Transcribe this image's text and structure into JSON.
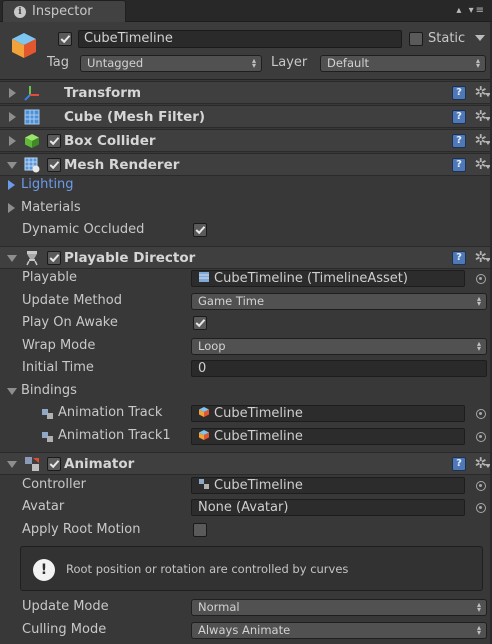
{
  "tab": {
    "title": "Inspector",
    "tools": "▴ ▾≡"
  },
  "header": {
    "name": "CubeTimeline",
    "static_label": "Static",
    "tag_label": "Tag",
    "tag_value": "Untagged",
    "layer_label": "Layer",
    "layer_value": "Default"
  },
  "components": {
    "transform": "Transform",
    "mesh_filter": "Cube (Mesh Filter)",
    "box_collider": "Box Collider",
    "mesh_renderer": "Mesh Renderer",
    "playable_director": "Playable Director",
    "animator": "Animator"
  },
  "mesh_renderer": {
    "lighting": "Lighting",
    "materials": "Materials",
    "dynamic_occluded": "Dynamic Occluded"
  },
  "playable_director": {
    "playable_label": "Playable",
    "playable_value": "CubeTimeline (TimelineAsset)",
    "update_method_label": "Update Method",
    "update_method_value": "Game Time",
    "play_on_awake_label": "Play On Awake",
    "wrap_mode_label": "Wrap Mode",
    "wrap_mode_value": "Loop",
    "initial_time_label": "Initial Time",
    "initial_time_value": "0",
    "bindings_label": "Bindings",
    "bindings": [
      {
        "track": "Animation Track",
        "value": "CubeTimeline"
      },
      {
        "track": "Animation Track1",
        "value": "CubeTimeline"
      }
    ]
  },
  "animator": {
    "controller_label": "Controller",
    "controller_value": "CubeTimeline",
    "avatar_label": "Avatar",
    "avatar_value": "None (Avatar)",
    "apply_root_motion_label": "Apply Root Motion",
    "help_message": "Root position or rotation are controlled by curves",
    "update_mode_label": "Update Mode",
    "update_mode_value": "Normal",
    "culling_mode_label": "Culling Mode",
    "culling_mode_value": "Always Animate"
  },
  "icons": {
    "help": "?",
    "gear": "✲",
    "warn": "!"
  },
  "colors": {
    "background": "#383838",
    "header": "#3f3f3f",
    "accent_blue": "#6b9bea",
    "help_blue": "#4f79b6"
  }
}
